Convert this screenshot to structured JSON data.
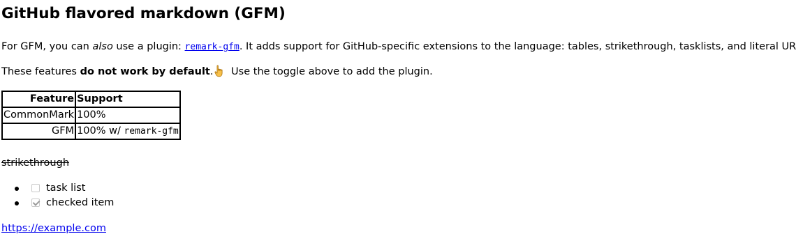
{
  "heading": "GitHub flavored markdown (GFM)",
  "intro": {
    "before": "For GFM, you can ",
    "emphasis": "also",
    "middle": " use a plugin: ",
    "plugin_link": "remark-gfm",
    "after": ". It adds support for GitHub-specific extensions to the language: tables, strikethrough, tasklists, and literal URLs."
  },
  "features_note": {
    "before": "These features ",
    "strong": "do not work by default",
    "period": ".",
    "icon": "pointing-hand-icon",
    "after": " Use the toggle above to add the plugin."
  },
  "table": {
    "headers": [
      "Feature",
      "Support"
    ],
    "rows": [
      {
        "feature": "CommonMark",
        "support": "100%"
      },
      {
        "feature": "GFM",
        "support_prefix": "100% w/ ",
        "support_code": "remark-gfm"
      }
    ]
  },
  "strikethrough_text": "strikethrough",
  "tasks": [
    {
      "label": "task list",
      "checked": false
    },
    {
      "label": "checked item",
      "checked": true
    }
  ],
  "url": "https://example.com"
}
